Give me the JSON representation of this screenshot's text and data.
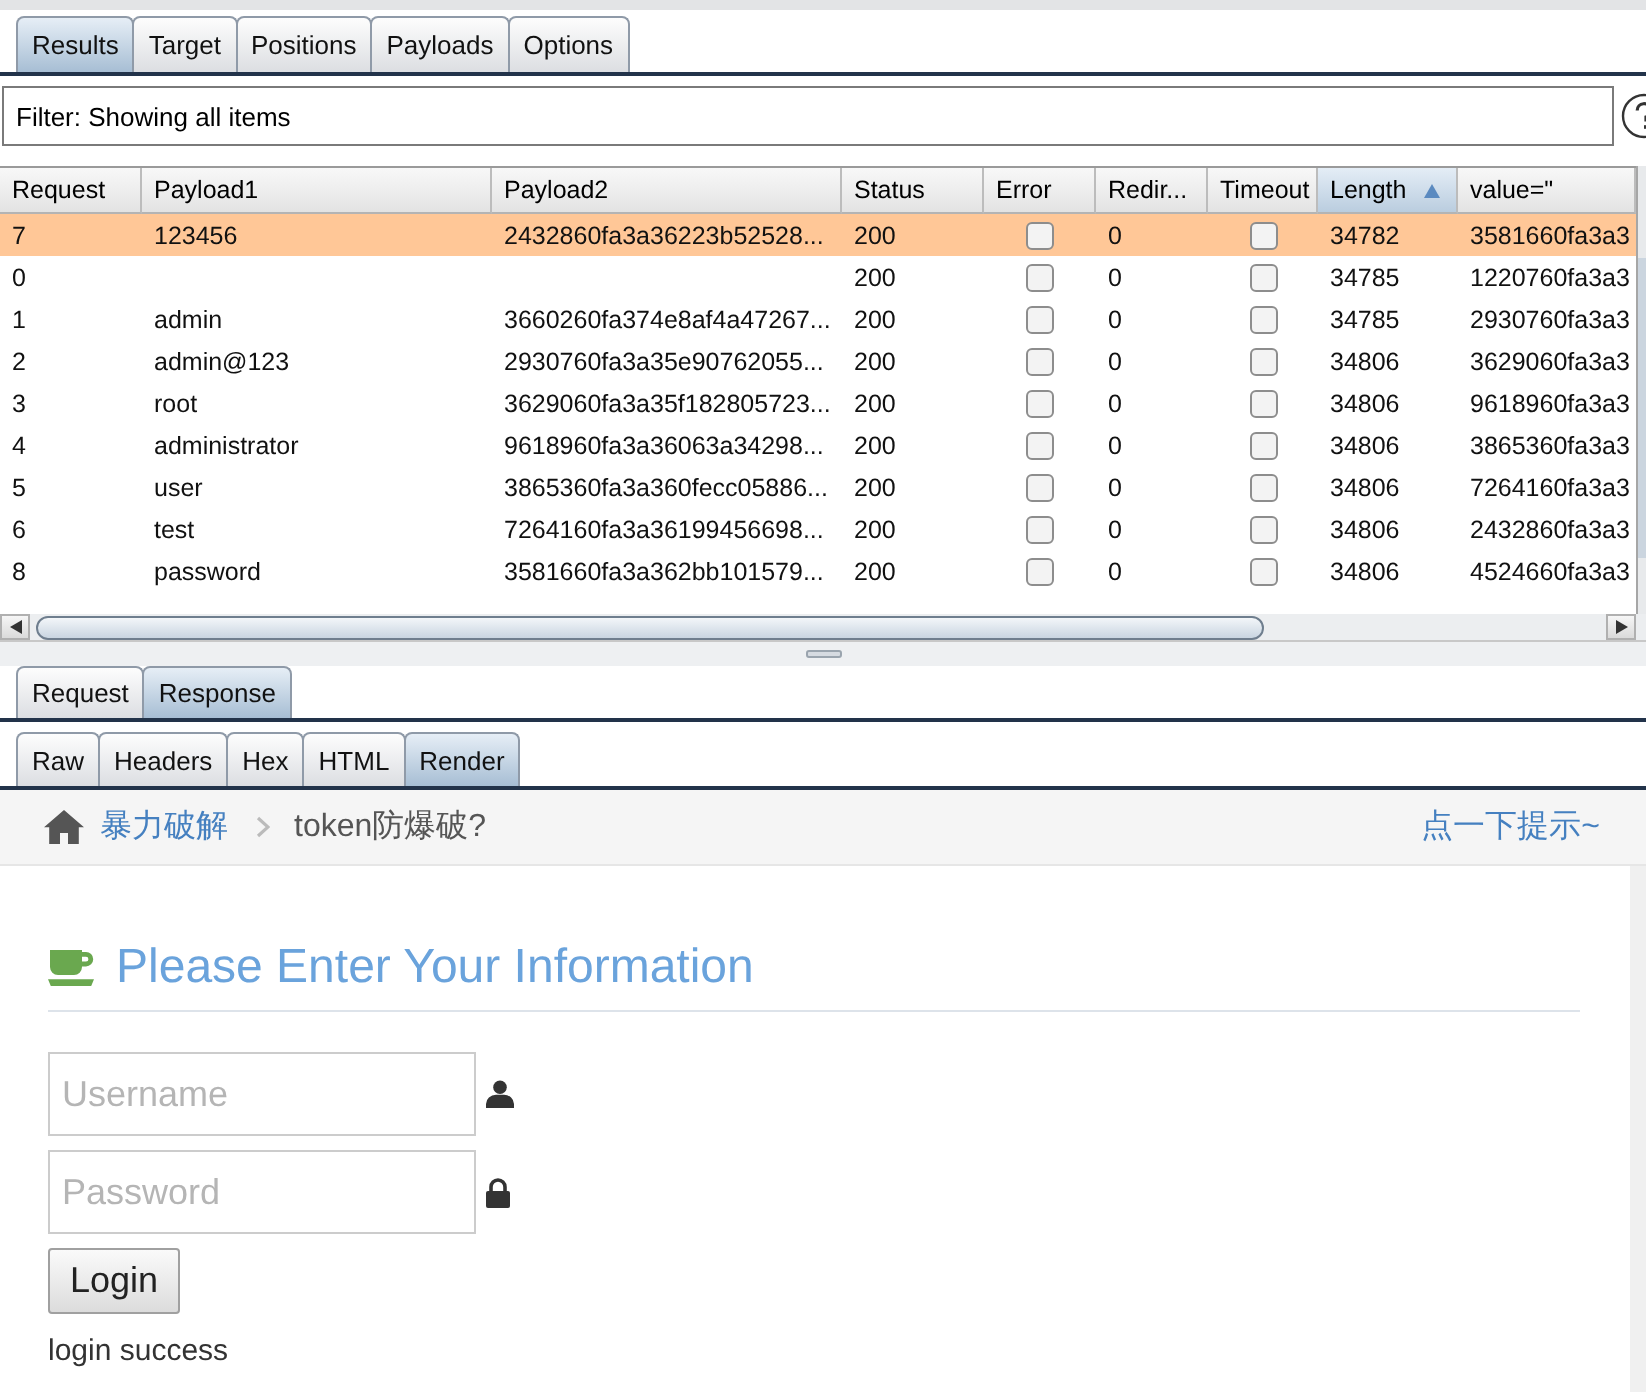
{
  "main_tabs": [
    {
      "label": "Results",
      "selected": true
    },
    {
      "label": "Target",
      "selected": false
    },
    {
      "label": "Positions",
      "selected": false
    },
    {
      "label": "Payloads",
      "selected": false
    },
    {
      "label": "Options",
      "selected": false
    }
  ],
  "filter": {
    "text": "Filter: Showing all items"
  },
  "table": {
    "columns": [
      {
        "label": "Request",
        "kind": "text",
        "sorted": false
      },
      {
        "label": "Payload1",
        "kind": "text",
        "sorted": false
      },
      {
        "label": "Payload2",
        "kind": "text",
        "sorted": false
      },
      {
        "label": "Status",
        "kind": "text",
        "sorted": false
      },
      {
        "label": "Error",
        "kind": "checkbox",
        "sorted": false
      },
      {
        "label": "Redir...",
        "kind": "text",
        "sorted": false
      },
      {
        "label": "Timeout",
        "kind": "checkbox",
        "sorted": false
      },
      {
        "label": "Length",
        "kind": "text",
        "sorted": true
      },
      {
        "label": "value=\"",
        "kind": "text",
        "sorted": false
      }
    ],
    "rows": [
      {
        "selected": true,
        "cells": [
          "7",
          "123456",
          "2432860fa3a36223b52528...",
          "200",
          false,
          "0",
          false,
          "34782",
          "3581660fa3a3"
        ]
      },
      {
        "selected": false,
        "cells": [
          "0",
          null,
          null,
          "200",
          false,
          "0",
          false,
          "34785",
          "1220760fa3a3"
        ]
      },
      {
        "selected": false,
        "cells": [
          "1",
          "admin",
          "3660260fa374e8af4a47267...",
          "200",
          false,
          "0",
          false,
          "34785",
          "2930760fa3a3"
        ]
      },
      {
        "selected": false,
        "cells": [
          "2",
          "admin@123",
          "2930760fa3a35e90762055...",
          "200",
          false,
          "0",
          false,
          "34806",
          "3629060fa3a3"
        ]
      },
      {
        "selected": false,
        "cells": [
          "3",
          "root",
          "3629060fa3a35f182805723...",
          "200",
          false,
          "0",
          false,
          "34806",
          "9618960fa3a3"
        ]
      },
      {
        "selected": false,
        "cells": [
          "4",
          "administrator",
          "9618960fa3a36063a34298...",
          "200",
          false,
          "0",
          false,
          "34806",
          "3865360fa3a3"
        ]
      },
      {
        "selected": false,
        "cells": [
          "5",
          "user",
          "3865360fa3a360fecc05886...",
          "200",
          false,
          "0",
          false,
          "34806",
          "7264160fa3a3"
        ]
      },
      {
        "selected": false,
        "cells": [
          "6",
          "test",
          "7264160fa3a36199456698...",
          "200",
          false,
          "0",
          false,
          "34806",
          "2432860fa3a3"
        ]
      },
      {
        "selected": false,
        "cells": [
          "8",
          "password",
          "3581660fa3a362bb101579...",
          "200",
          false,
          "0",
          false,
          "34806",
          "4524660fa3a3"
        ]
      }
    ]
  },
  "response_tabs": [
    {
      "label": "Request",
      "selected": false
    },
    {
      "label": "Response",
      "selected": true
    }
  ],
  "view_tabs": [
    {
      "label": "Raw",
      "selected": false
    },
    {
      "label": "Headers",
      "selected": false
    },
    {
      "label": "Hex",
      "selected": false
    },
    {
      "label": "HTML",
      "selected": false
    },
    {
      "label": "Render",
      "selected": true
    }
  ],
  "render": {
    "breadcrumb": [
      {
        "label": "暴力破解",
        "kind": "link"
      },
      {
        "label": "token防爆破?",
        "kind": "current"
      }
    ],
    "hint": "点一下提示~",
    "heading": "Please Enter Your Information",
    "fields": [
      {
        "placeholder": "Username",
        "kind": "user"
      },
      {
        "placeholder": "Password",
        "kind": "lock"
      }
    ],
    "button": "Login",
    "message": "login success"
  }
}
